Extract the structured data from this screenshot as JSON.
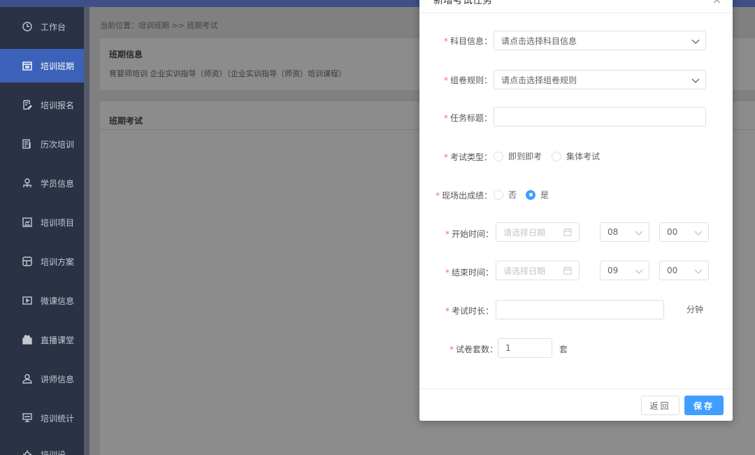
{
  "sidebar": {
    "items": [
      {
        "label": "工作台",
        "icon": "clock-icon"
      },
      {
        "label": "培训班期",
        "icon": "calendar-icon",
        "active": true
      },
      {
        "label": "培训报名",
        "icon": "edit-form-icon"
      },
      {
        "label": "历次培训",
        "icon": "document-list-icon"
      },
      {
        "label": "学员信息",
        "icon": "student-icon"
      },
      {
        "label": "培训项目",
        "icon": "project-icon"
      },
      {
        "label": "培训方案",
        "icon": "plan-icon"
      },
      {
        "label": "微课信息",
        "icon": "video-icon"
      },
      {
        "label": "直播课堂",
        "icon": "live-camera-icon"
      },
      {
        "label": "讲师信息",
        "icon": "teacher-icon"
      },
      {
        "label": "培训统计",
        "icon": "monitor-icon"
      },
      {
        "label": "培训设",
        "icon": "gear-icon"
      }
    ]
  },
  "breadcrumb": "当前位置：培训班期 >> 班期考试",
  "info_panel": {
    "title": "班期信息",
    "subtitle": "育婴师培训    企业实训指导（师资）（企业实训指导（师资）培训课程）"
  },
  "exam_panel": {
    "title": "班期考试"
  },
  "modal": {
    "title": "新增考试任务",
    "close": "×",
    "fields": {
      "subject": {
        "label": "科目信息：",
        "placeholder": "请点击选择科目信息"
      },
      "rule": {
        "label": "组卷规则：",
        "placeholder": "请点击选择组卷规则"
      },
      "task_title": {
        "label": "任务标题：",
        "value": ""
      },
      "exam_type": {
        "label": "考试类型：",
        "options": [
          "即到即考",
          "集体考试"
        ]
      },
      "onsite_score": {
        "label": "现场出成绩：",
        "options": [
          "否",
          "是"
        ],
        "selected": "是"
      },
      "start_time": {
        "label": "开始时间：",
        "date_placeholder": "请选择日期",
        "hour": "08",
        "minute": "00"
      },
      "end_time": {
        "label": "结束时间：",
        "date_placeholder": "请选择日期",
        "hour": "09",
        "minute": "00"
      },
      "duration": {
        "label": "考试时长：",
        "value": "",
        "unit": "分钟"
      },
      "paper_sets": {
        "label": "试卷套数：",
        "value": "1",
        "unit": "套"
      }
    },
    "buttons": {
      "back": "返回",
      "save": "保存"
    },
    "required_mark": "*"
  },
  "colors": {
    "sidebar_bg": "#2b3245",
    "sidebar_active": "#3b62b8",
    "primary": "#409eff",
    "required": "#f56c6c"
  }
}
